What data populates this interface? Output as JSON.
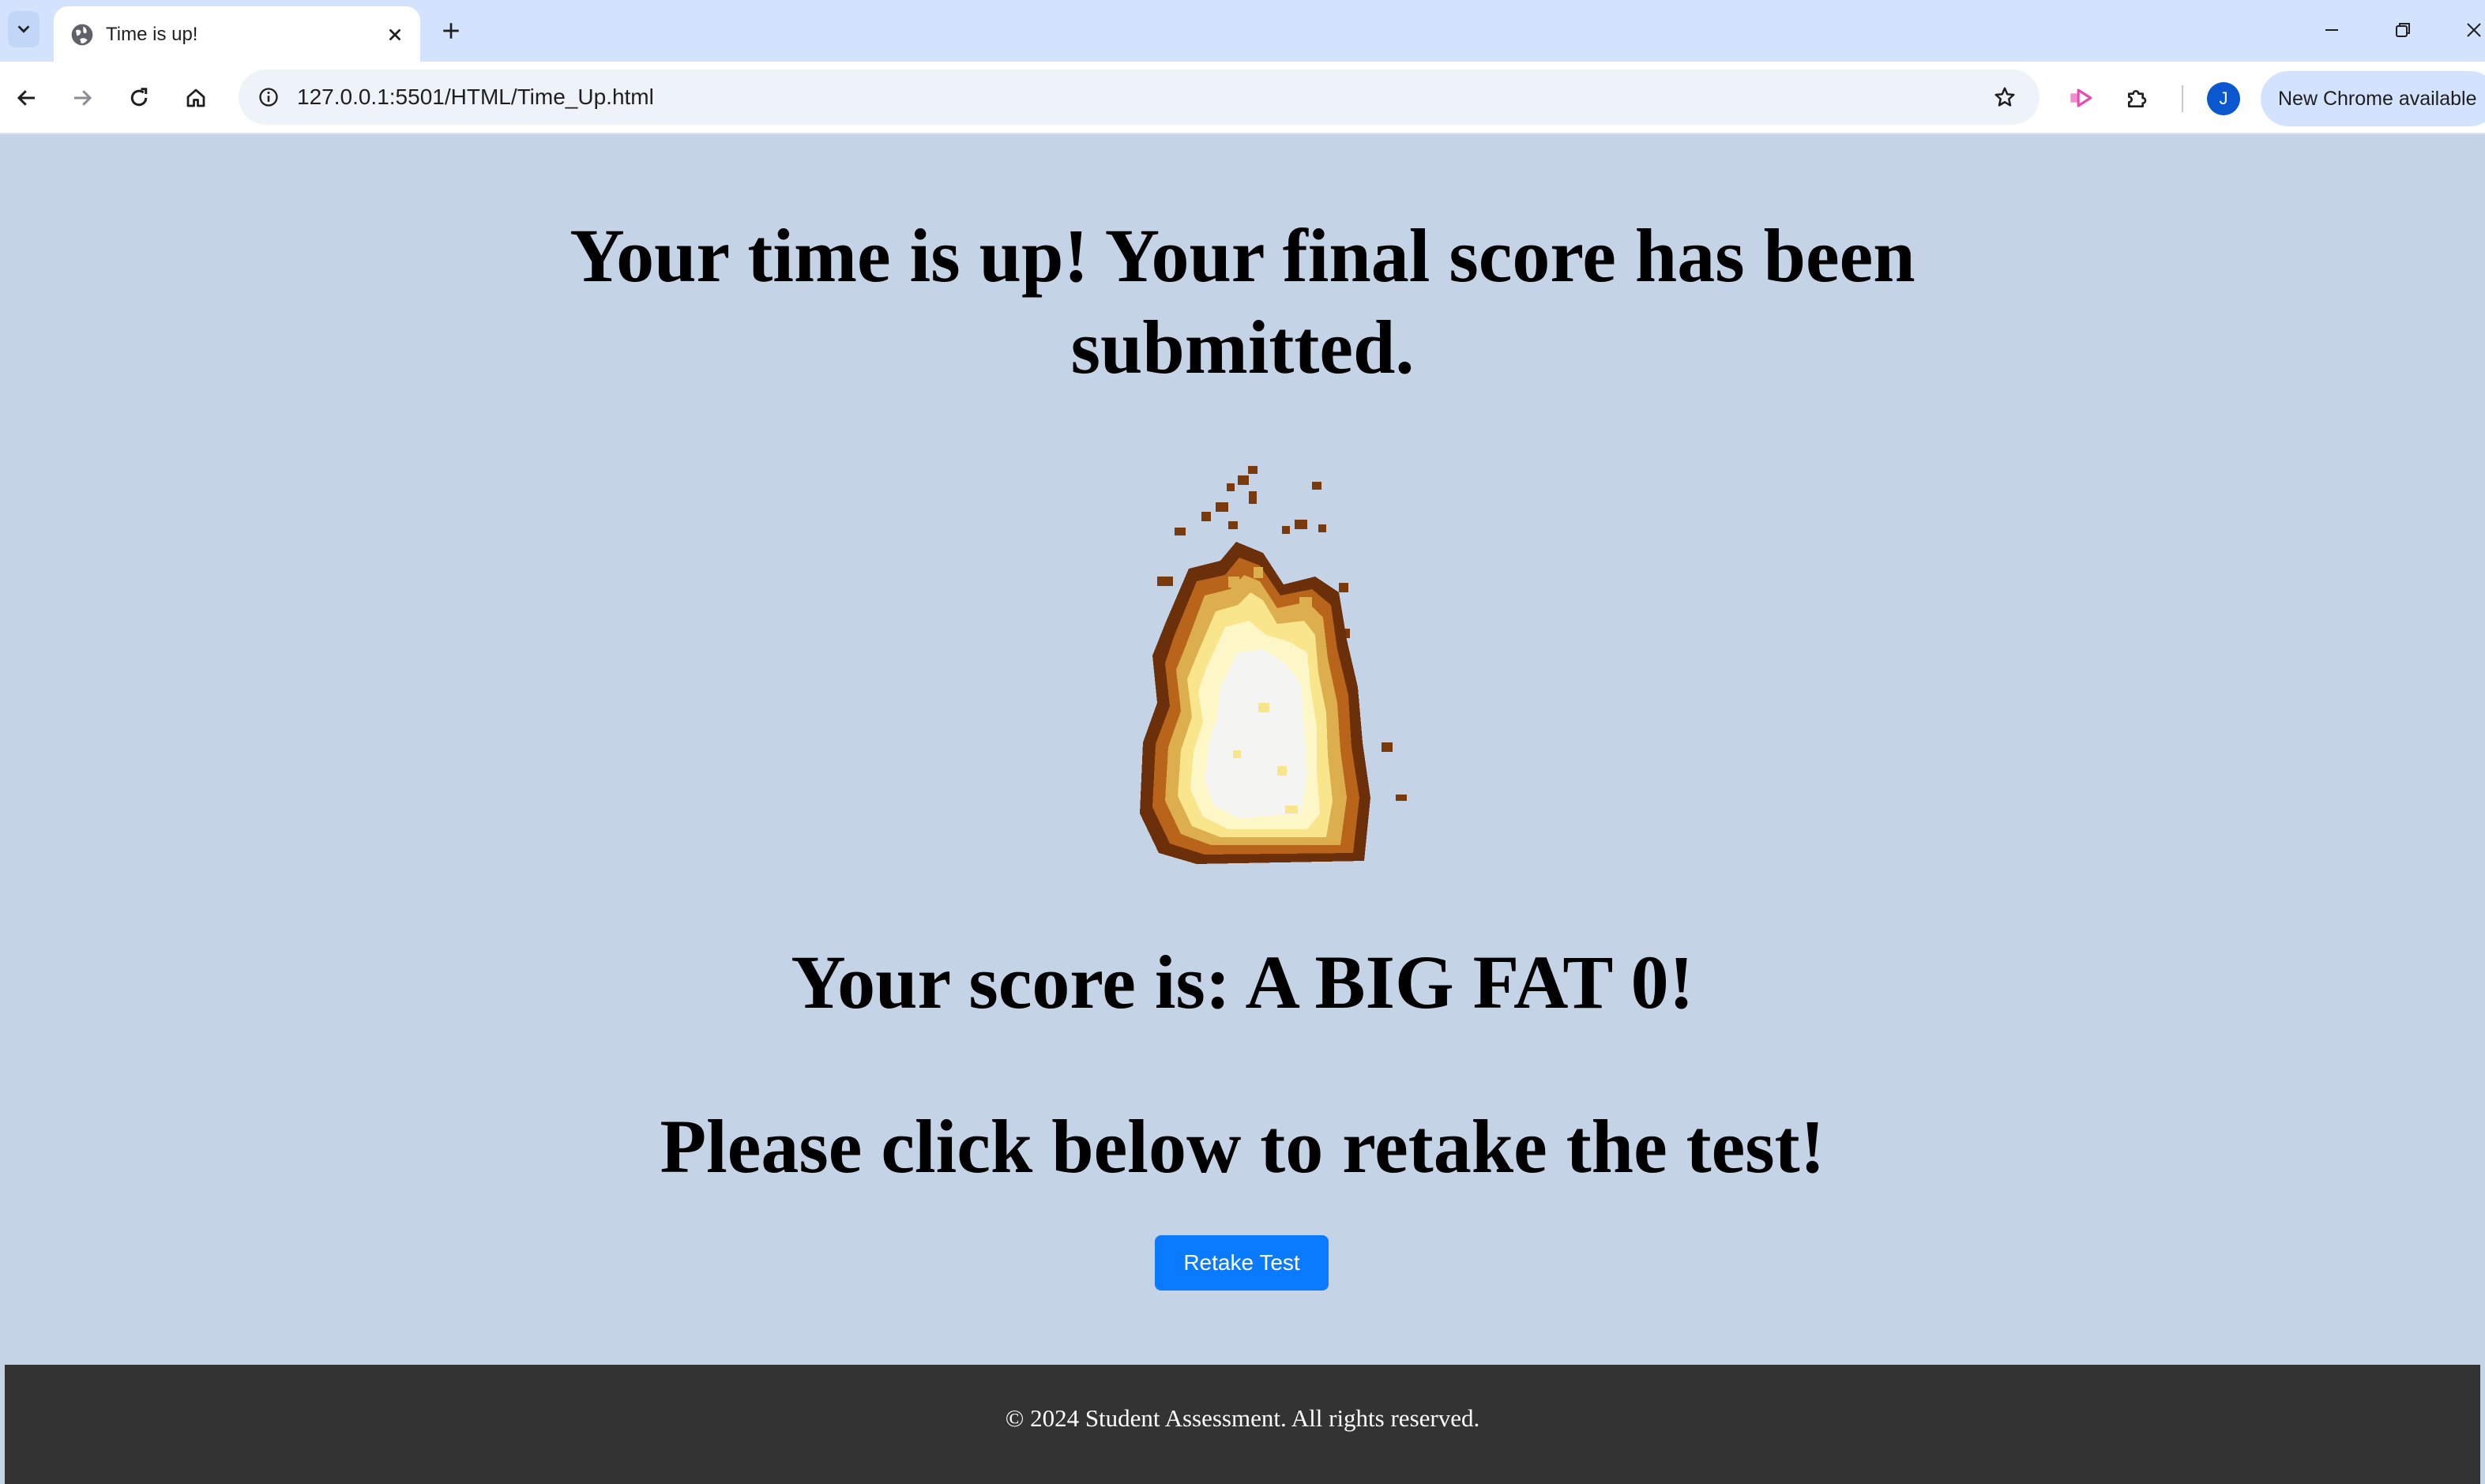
{
  "browser": {
    "tab_title": "Time is up!",
    "url": "127.0.0.1:5501/HTML/Time_Up.html",
    "update_label": "New Chrome available",
    "profile_initial": "J",
    "icons": {
      "tab_dropdown": "chevron-down-icon",
      "favicon": "globe-icon",
      "tab_close": "close-icon",
      "new_tab": "plus-icon",
      "back": "arrow-left-icon",
      "forward": "arrow-right-icon",
      "reload": "reload-icon",
      "home": "home-icon",
      "site_info": "info-icon",
      "bookmark": "star-icon",
      "extension_pink": "cast-icon",
      "extensions": "puzzle-icon"
    }
  },
  "page": {
    "headline": "Your time is up! Your final score has been submitted.",
    "score_text": "Your score is: A BIG FAT 0!",
    "prompt_text": "Please click below to retake the test!",
    "retake_button": "Retake Test",
    "footer": "© 2024 Student Assessment. All rights reserved."
  },
  "colors": {
    "page_background": "#c5d3e6",
    "button": "#0a7bff",
    "footer": "#333333",
    "tabbar": "#d3e3fd"
  }
}
